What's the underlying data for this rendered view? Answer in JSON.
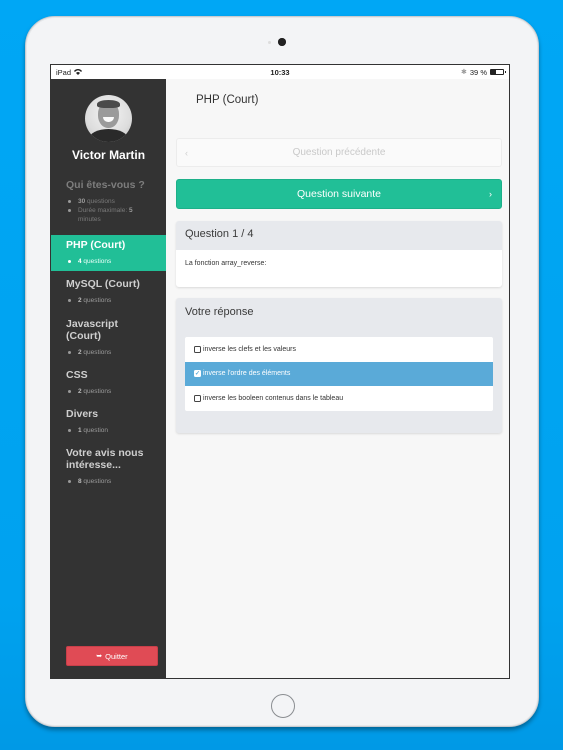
{
  "device": {
    "status_bar": {
      "carrier": "iPad",
      "wifi_icon": "wifi-icon",
      "time": "10:33",
      "bluetooth_icon": "bluetooth-icon",
      "battery_label": "39 %",
      "battery_level": 0.39
    }
  },
  "sidebar": {
    "user_name": "Victor Martin",
    "sections": [
      {
        "title": "Qui êtes-vous ?",
        "state": "done",
        "items": [
          {
            "count": "30",
            "text": " questions"
          },
          {
            "count": "",
            "text": "Durée maximale: ",
            "suffix": "5",
            "suffix2": " minutes"
          }
        ]
      },
      {
        "title": "PHP (Court)",
        "state": "active",
        "items": [
          {
            "count": "4",
            "text": " questions"
          }
        ]
      },
      {
        "title": "MySQL (Court)",
        "state": "pending",
        "items": [
          {
            "count": "2",
            "text": " questions"
          }
        ]
      },
      {
        "title": "Javascript (Court)",
        "state": "pending",
        "items": [
          {
            "count": "2",
            "text": " questions"
          }
        ]
      },
      {
        "title": "CSS",
        "state": "pending",
        "items": [
          {
            "count": "2",
            "text": " questions"
          }
        ]
      },
      {
        "title": "Divers",
        "state": "pending",
        "items": [
          {
            "count": "1",
            "text": " question"
          }
        ]
      },
      {
        "title": "Votre avis nous intéresse...",
        "state": "pending",
        "items": [
          {
            "count": "8",
            "text": " questions"
          }
        ]
      }
    ],
    "quit_label": "Quitter",
    "quit_icon": "sign-out-icon"
  },
  "main": {
    "page_title": "PHP (Court)",
    "prev_label": "Question précédente",
    "next_label": "Question suivante",
    "question": {
      "header": "Question 1 / 4",
      "text": "La fonction array_reverse:"
    },
    "answer": {
      "header": "Votre réponse",
      "options": [
        {
          "label": "inverse les clefs et les valeurs",
          "checked": false
        },
        {
          "label": "inverse l'ordre des éléments",
          "checked": true
        },
        {
          "label": "inverse les booleen contenus dans le tableau",
          "checked": false
        }
      ]
    }
  },
  "colors": {
    "accent": "#21bf97",
    "selected": "#5aaad8",
    "danger": "#e04b55",
    "sidebar_bg": "#333333",
    "background": "#00a7f5"
  }
}
